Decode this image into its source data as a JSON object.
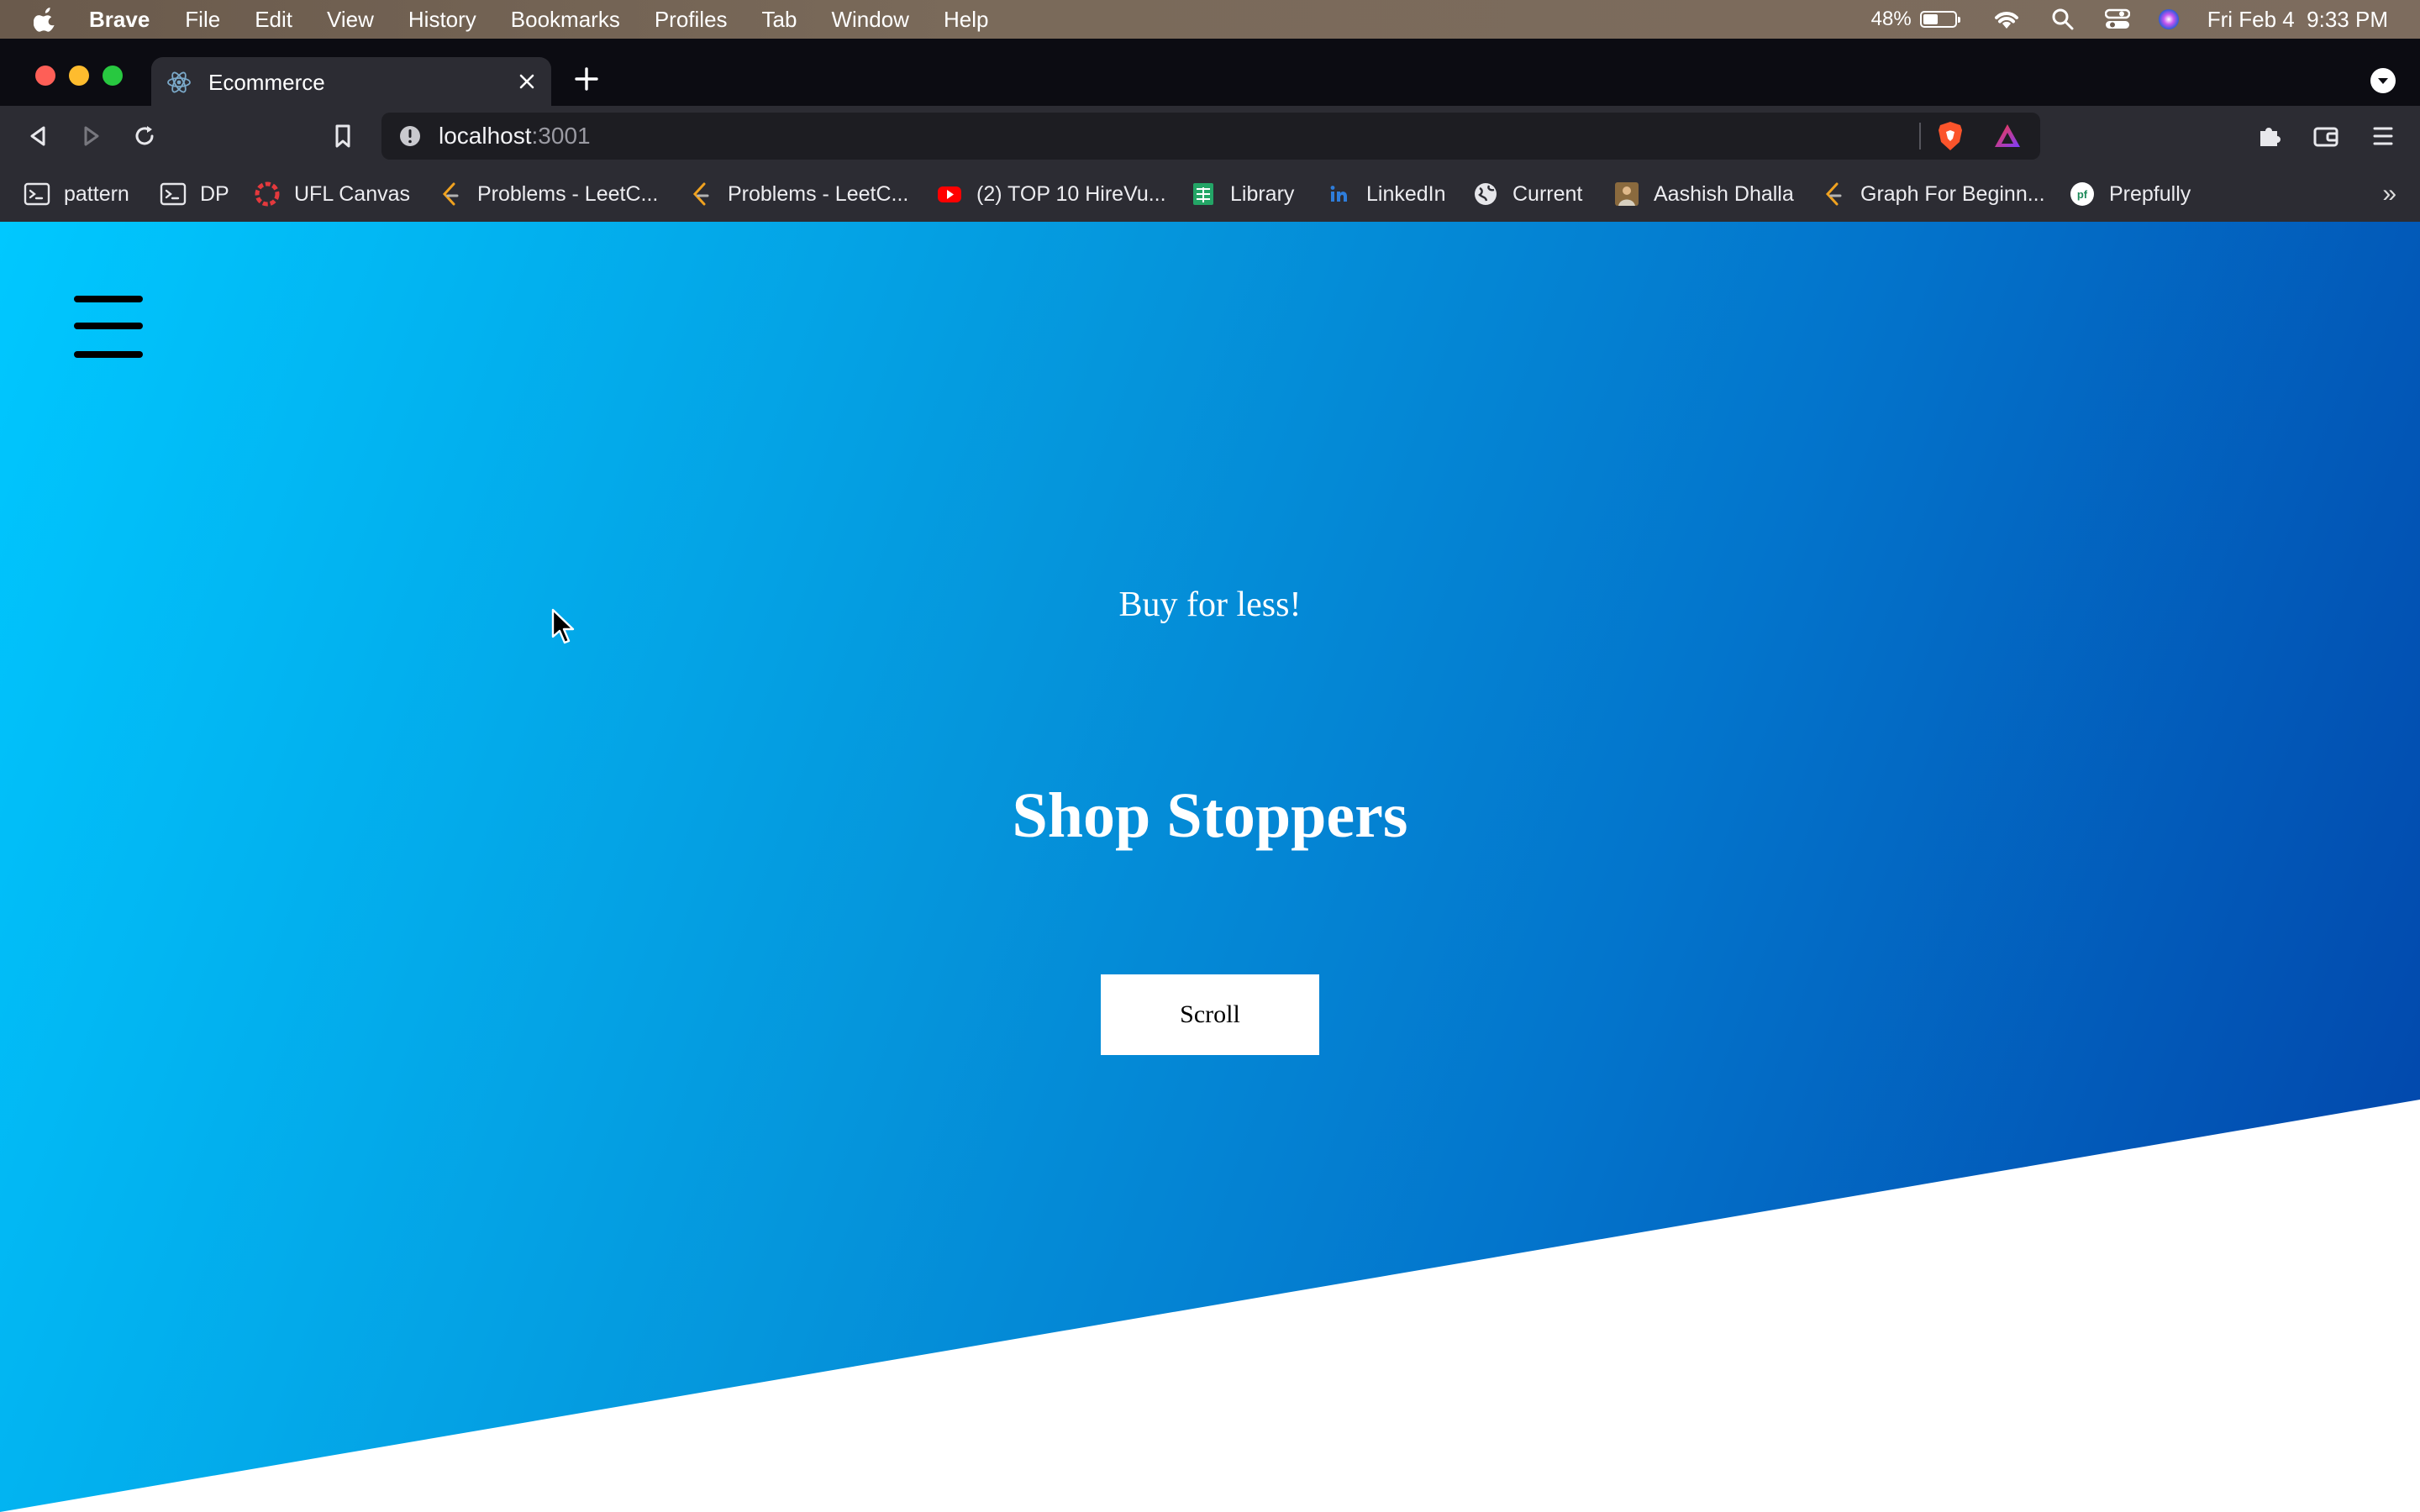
{
  "menubar": {
    "app_name": "Brave",
    "menus": [
      "File",
      "Edit",
      "View",
      "History",
      "Bookmarks",
      "Profiles",
      "Tab",
      "Window",
      "Help"
    ],
    "battery_percent": "48%",
    "battery_level": 0.48,
    "datetime": "Fri Feb 4  9:33 PM"
  },
  "browser": {
    "tab_title": "Ecommerce",
    "url_host": "localhost",
    "url_port": ":3001",
    "bookmarks": [
      {
        "label": "pattern",
        "icon": "terminal-icon"
      },
      {
        "label": "DP",
        "icon": "terminal-icon"
      },
      {
        "label": "UFL Canvas",
        "icon": "canvas-icon"
      },
      {
        "label": "Problems - LeetC...",
        "icon": "leetcode-icon"
      },
      {
        "label": "Problems - LeetC...",
        "icon": "leetcode-icon"
      },
      {
        "label": "(2) TOP 10 HireVu...",
        "icon": "youtube-icon"
      },
      {
        "label": "Library",
        "icon": "sheets-icon"
      },
      {
        "label": "LinkedIn",
        "icon": "linkedin-icon"
      },
      {
        "label": "Current",
        "icon": "globe-icon"
      },
      {
        "label": "Aashish Dhalla",
        "icon": "photo-icon"
      },
      {
        "label": "Graph For Beginn...",
        "icon": "leetcode-icon"
      },
      {
        "label": "Prepfully",
        "icon": "prepfully-icon"
      }
    ],
    "bookmarks_more": "»"
  },
  "page": {
    "tagline": "Buy for less!",
    "title": "Shop Stoppers",
    "scroll_button": "Scroll"
  },
  "colors": {
    "hero_gradient_start": "#00c8ff",
    "hero_gradient_end": "#0242a8",
    "button_bg": "#ffffff"
  }
}
